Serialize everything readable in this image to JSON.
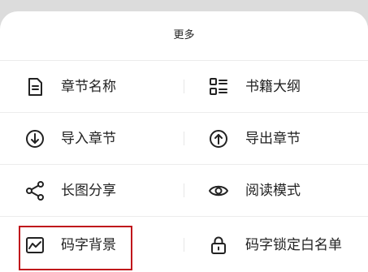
{
  "sheet": {
    "title": "更多"
  },
  "items": [
    {
      "label": "章节名称",
      "icon": "document-icon"
    },
    {
      "label": "书籍大纲",
      "icon": "outline-icon"
    },
    {
      "label": "导入章节",
      "icon": "import-icon"
    },
    {
      "label": "导出章节",
      "icon": "export-icon"
    },
    {
      "label": "长图分享",
      "icon": "share-icon"
    },
    {
      "label": "阅读模式",
      "icon": "eye-icon"
    },
    {
      "label": "码字背景",
      "icon": "background-image-icon"
    },
    {
      "label": "码字锁定白名单",
      "icon": "lock-icon"
    }
  ],
  "highlight_color": "#c0141b"
}
